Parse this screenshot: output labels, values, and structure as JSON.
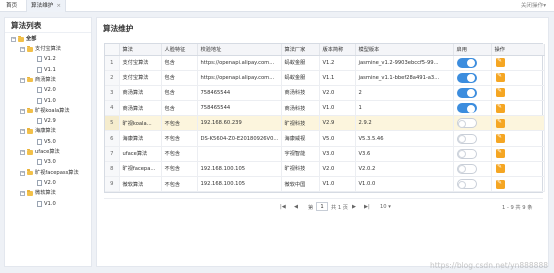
{
  "topbar": {
    "home_tab": "首页",
    "active_tab": "算法维护",
    "close_icon": "×",
    "close_ops": "关闭操作▾"
  },
  "left": {
    "title": "算法列表",
    "root": {
      "toggle": "−",
      "label": "全部"
    },
    "groups": [
      {
        "label": "支付宝算法",
        "children": [
          "V1.2",
          "V1.1"
        ]
      },
      {
        "label": "商汤算法",
        "children": [
          "V2.0",
          "V1.0"
        ]
      },
      {
        "label": "旷视koala算法",
        "children": [
          "V2.9"
        ]
      },
      {
        "label": "海康算法",
        "children": [
          "V5.0"
        ]
      },
      {
        "label": "uface算法",
        "children": [
          "V3.0"
        ]
      },
      {
        "label": "旷视facepass算法",
        "children": [
          "V2.0"
        ]
      },
      {
        "label": "微软算法",
        "children": [
          "V1.0"
        ]
      }
    ],
    "group_toggle": "−"
  },
  "right": {
    "title": "算法维护",
    "columns": [
      "",
      "算法",
      "人脸特征",
      "校验地址",
      "算法厂家",
      "版本简称",
      "模型版本",
      "启用",
      "操作"
    ],
    "rows": [
      {
        "idx": "1",
        "algo": "支付宝算法",
        "feature": "包含",
        "url": "https://openapi.alipay.com...",
        "vendor": "蚂蚁金服",
        "ver": "V1.2",
        "model": "jasmine_v1.2-9903ebccf5-99...",
        "enabled": true,
        "highlight": false
      },
      {
        "idx": "2",
        "algo": "支付宝算法",
        "feature": "包含",
        "url": "https://openapi.alipay.com...",
        "vendor": "蚂蚁金服",
        "ver": "V1.1",
        "model": "jasmine_v1.1-bbef28a491-a3...",
        "enabled": true,
        "highlight": false
      },
      {
        "idx": "3",
        "algo": "商汤算法",
        "feature": "包含",
        "url": "758465544",
        "vendor": "商汤科技",
        "ver": "V2.0",
        "model": "2",
        "enabled": true,
        "highlight": false
      },
      {
        "idx": "4",
        "algo": "商汤算法",
        "feature": "包含",
        "url": "758465544",
        "vendor": "商汤科技",
        "ver": "V1.0",
        "model": "1",
        "enabled": true,
        "highlight": false
      },
      {
        "idx": "5",
        "algo": "旷视koala...",
        "feature": "不包含",
        "url": "192.168.60.239",
        "vendor": "旷视科技",
        "ver": "V2.9",
        "model": "2.9.2",
        "enabled": false,
        "highlight": true
      },
      {
        "idx": "6",
        "algo": "海康算法",
        "feature": "不包含",
        "url": "DS-K5604-Z0-E20180926V0...",
        "vendor": "海康威视",
        "ver": "V5.0",
        "model": "V5.3.5.46",
        "enabled": false,
        "highlight": false
      },
      {
        "idx": "7",
        "algo": "uface算法",
        "feature": "不包含",
        "url": "",
        "vendor": "宇视智能",
        "ver": "V3.0",
        "model": "V3.6",
        "enabled": false,
        "highlight": false
      },
      {
        "idx": "8",
        "algo": "旷视facepa...",
        "feature": "不包含",
        "url": "192.168.100.105",
        "vendor": "旷视科技",
        "ver": "V2.0",
        "model": "V2.0.2",
        "enabled": false,
        "highlight": false
      },
      {
        "idx": "9",
        "algo": "微软算法",
        "feature": "不包含",
        "url": "192.168.100.105",
        "vendor": "微软中国",
        "ver": "V1.0",
        "model": "V1.0.0",
        "enabled": false,
        "highlight": false
      }
    ],
    "pager": {
      "first": "|◀",
      "prev": "◀",
      "page_label": "第",
      "page": "1",
      "total_label": "共 1 页",
      "next": "▶",
      "last": "▶|",
      "page_size": "10 ▾",
      "summary": "1 - 9 共 9 条"
    }
  },
  "watermark": "https://blog.csdn.net/yn888888"
}
